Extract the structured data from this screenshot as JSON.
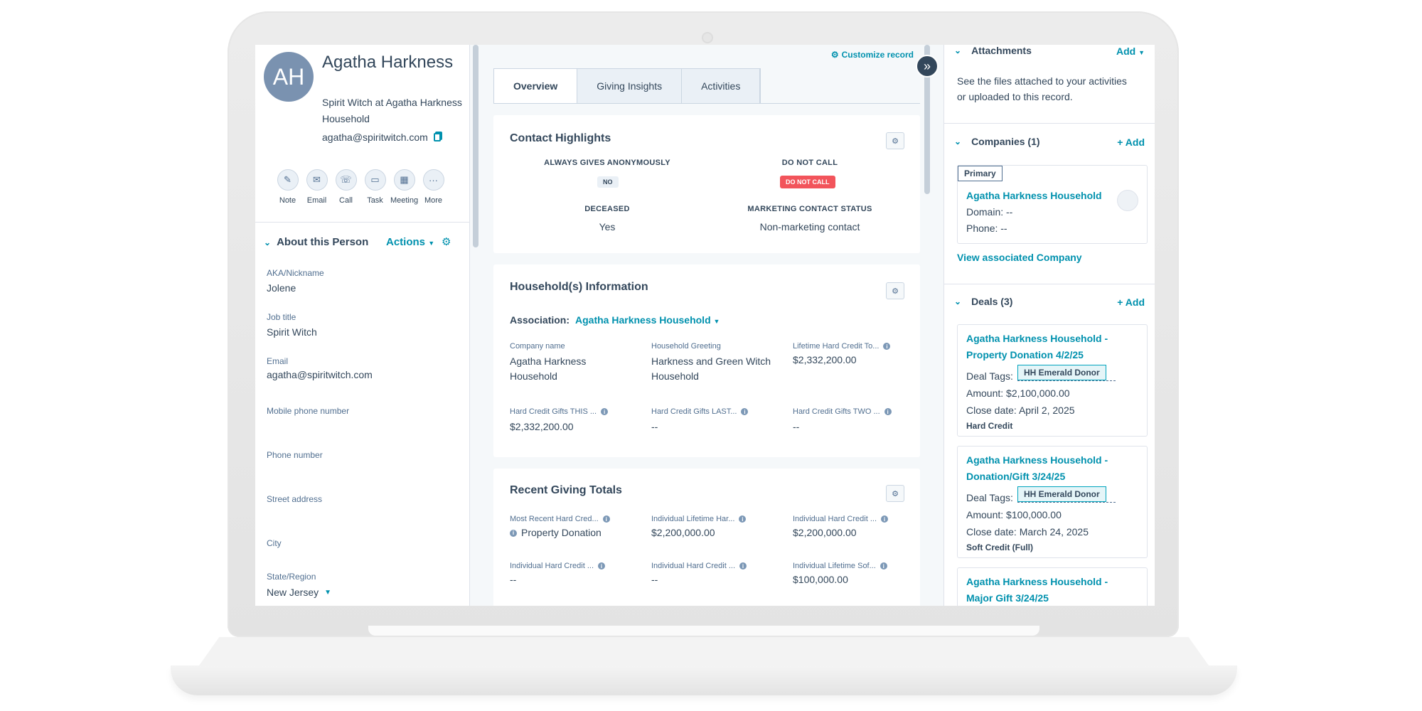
{
  "contact": {
    "initials": "AH",
    "name": "Agatha Harkness",
    "subtitle": "Spirit Witch at Agatha Harkness Household",
    "email": "agatha@spiritwitch.com"
  },
  "quick_actions": [
    {
      "label": "Note",
      "icon": "note-icon",
      "glyph": "✎"
    },
    {
      "label": "Email",
      "icon": "email-icon",
      "glyph": "✉"
    },
    {
      "label": "Call",
      "icon": "phone-icon",
      "glyph": "☏"
    },
    {
      "label": "Task",
      "icon": "task-icon",
      "glyph": "▭"
    },
    {
      "label": "Meeting",
      "icon": "calendar-icon",
      "glyph": "▦"
    },
    {
      "label": "More",
      "icon": "more-icon",
      "glyph": "···"
    }
  ],
  "about": {
    "title": "About this Person",
    "actions_label": "Actions",
    "fields": [
      {
        "label": "AKA/Nickname",
        "value": "Jolene"
      },
      {
        "label": "Job title",
        "value": "Spirit Witch"
      },
      {
        "label": "Email",
        "value": "agatha@spiritwitch.com"
      },
      {
        "label": "Mobile phone number",
        "value": ""
      },
      {
        "label": "Phone number",
        "value": ""
      },
      {
        "label": "Street address",
        "value": ""
      },
      {
        "label": "City",
        "value": ""
      },
      {
        "label": "State/Region",
        "value": "New Jersey"
      }
    ]
  },
  "middle": {
    "customize_label": "Customize record",
    "tabs": [
      "Overview",
      "Giving Insights",
      "Activities"
    ],
    "highlights": {
      "title": "Contact Highlights",
      "items": [
        {
          "label": "Always gives anonymously",
          "value": "NO"
        },
        {
          "label": "Do not call",
          "value": "DO NOT CALL"
        },
        {
          "label": "Deceased",
          "value": "Yes"
        },
        {
          "label": "Marketing contact status",
          "value": "Non-marketing contact"
        }
      ]
    },
    "household": {
      "title": "Household(s) Information",
      "association_label": "Association:",
      "association_value": "Agatha Harkness Household",
      "props": [
        {
          "label": "Company name",
          "value": "Agatha Harkness Household"
        },
        {
          "label": "Household Greeting",
          "value": "Harkness and Green Witch Household"
        },
        {
          "label": "Lifetime Hard Credit To...",
          "value": "$2,332,200.00"
        },
        {
          "label": "Hard Credit Gifts THIS ...",
          "value": "$2,332,200.00"
        },
        {
          "label": "Hard Credit Gifts LAST...",
          "value": "--"
        },
        {
          "label": "Hard Credit Gifts TWO ...",
          "value": "--"
        }
      ]
    },
    "giving": {
      "title": "Recent Giving Totals",
      "props": [
        {
          "label": "Most Recent Hard Cred...",
          "value": "Property Donation"
        },
        {
          "label": "Individual Lifetime Har...",
          "value": "$2,200,000.00"
        },
        {
          "label": "Individual Hard Credit ...",
          "value": "$2,200,000.00"
        },
        {
          "label": "Individual Hard Credit ...",
          "value": "--"
        },
        {
          "label": "Individual Hard Credit ...",
          "value": "--"
        },
        {
          "label": "Individual Lifetime Sof...",
          "value": "$100,000.00"
        }
      ]
    }
  },
  "right": {
    "attachments": {
      "title": "Attachments",
      "add_label": "Add",
      "text": "See the files attached to your activities or uploaded to this record."
    },
    "companies": {
      "title": "Companies (1)",
      "add_label": "+ Add",
      "primary_tag": "Primary",
      "name": "Agatha Harkness Household",
      "domain": "Domain: --",
      "phone": "Phone: --",
      "view_link": "View associated Company"
    },
    "deals": {
      "title": "Deals (3)",
      "add_label": "+ Add",
      "tags_label": "Deal Tags:",
      "items": [
        {
          "name": "Agatha Harkness Household - Property Donation 4/2/25",
          "tag": "HH Emerald Donor",
          "amount": "Amount: $2,100,000.00",
          "close": "Close date: April 2, 2025",
          "credit": "Hard Credit"
        },
        {
          "name": "Agatha Harkness Household - Donation/Gift 3/24/25",
          "tag": "HH Emerald Donor",
          "amount": "Amount: $100,000.00",
          "close": "Close date: March 24, 2025",
          "credit": "Soft Credit (Full)"
        },
        {
          "name": "Agatha Harkness Household - Major Gift 3/24/25",
          "tag": "",
          "amount": "",
          "close": "",
          "credit": ""
        }
      ]
    }
  },
  "colors": {
    "accent": "#0091ae",
    "text": "#33475b",
    "avatar": "#7a92b0",
    "danger": "#f2545b",
    "tag_bg": "#e5f5f8"
  }
}
